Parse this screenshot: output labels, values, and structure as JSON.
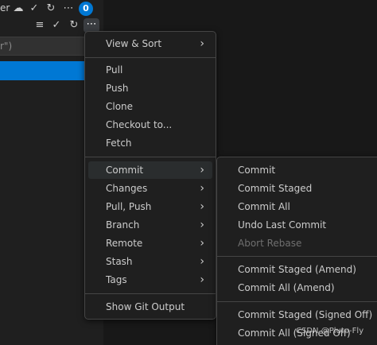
{
  "header": {
    "title_fragment": "er",
    "badge_count": "0"
  },
  "input": {
    "placeholder_fragment": "r\")"
  },
  "menu": {
    "items": [
      {
        "label": "View & Sort"
      },
      {
        "label": "Pull"
      },
      {
        "label": "Push"
      },
      {
        "label": "Clone"
      },
      {
        "label": "Checkout to..."
      },
      {
        "label": "Fetch"
      },
      {
        "label": "Commit"
      },
      {
        "label": "Changes"
      },
      {
        "label": "Pull, Push"
      },
      {
        "label": "Branch"
      },
      {
        "label": "Remote"
      },
      {
        "label": "Stash"
      },
      {
        "label": "Tags"
      },
      {
        "label": "Show Git Output"
      }
    ]
  },
  "submenu": {
    "items": [
      {
        "label": "Commit"
      },
      {
        "label": "Commit Staged"
      },
      {
        "label": "Commit All"
      },
      {
        "label": "Undo Last Commit"
      },
      {
        "label": "Abort Rebase"
      },
      {
        "label": "Commit Staged (Amend)"
      },
      {
        "label": "Commit All (Amend)"
      },
      {
        "label": "Commit Staged (Signed Off)"
      },
      {
        "label": "Commit All (Signed Off)"
      }
    ]
  },
  "watermark": "CSDN @Pluto-Fly",
  "icons": {
    "chevron": "chevron-right-icon",
    "check": "check-icon",
    "refresh": "refresh-icon",
    "more": "more-icon"
  },
  "colors": {
    "accent": "#0078d4",
    "menu_bg": "#1f1f1f",
    "text": "#cccccc",
    "disabled_text": "#6f6f6f"
  }
}
